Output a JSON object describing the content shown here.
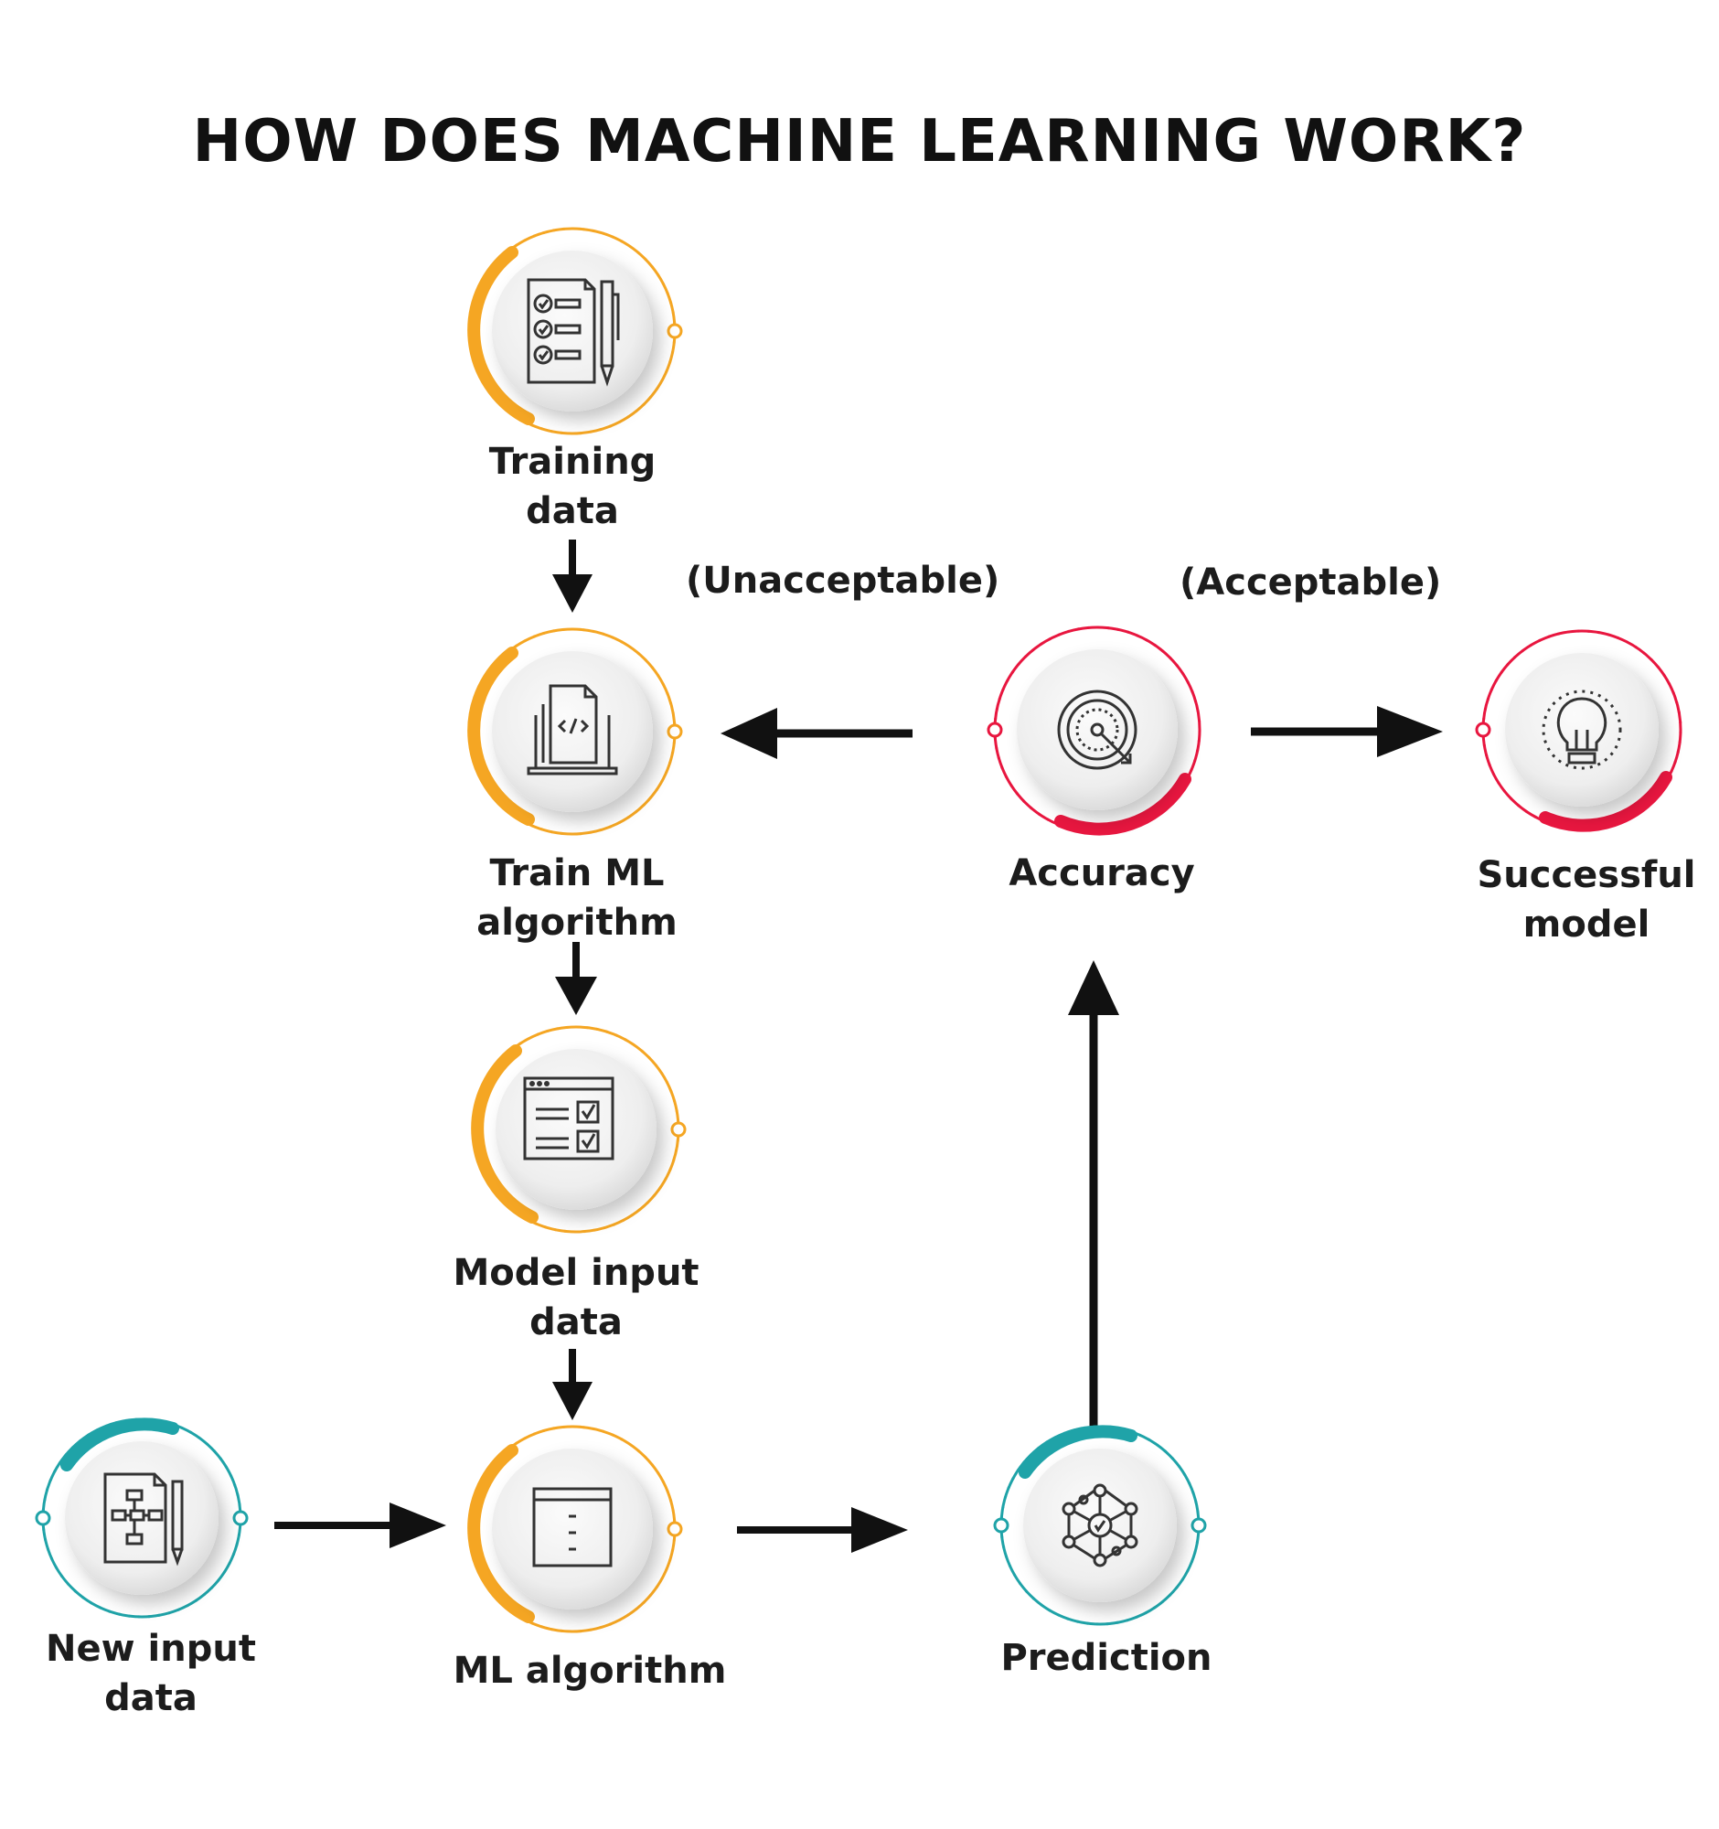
{
  "title": "HOW DOES MACHINE LEARNING WORK?",
  "nodes": {
    "training_data": {
      "line1": "Training",
      "line2": "data",
      "icon": "checklist-icon",
      "color": "#f5a623"
    },
    "train_ml_algorithm": {
      "line1": "Train ML",
      "line2": "algorithm",
      "icon": "code-file-laptop-icon",
      "color": "#f5a623"
    },
    "model_input_data": {
      "line1": "Model input",
      "line2": "data",
      "icon": "form-checkbox-icon",
      "color": "#f5a623"
    },
    "ml_algorithm": {
      "line1": "ML algorithm",
      "icon": "window-list-icon",
      "color": "#f5a623"
    },
    "new_input_data": {
      "line1": "New input",
      "line2": "data",
      "icon": "flowchart-document-icon",
      "color": "#1fa3a8"
    },
    "prediction": {
      "line1": "Prediction",
      "icon": "network-nodes-icon",
      "color": "#1fa3a8"
    },
    "accuracy": {
      "line1": "Accuracy",
      "icon": "target-icon",
      "color": "#e8163f"
    },
    "successful_model": {
      "line1": "Successful",
      "line2": "model",
      "icon": "lightbulb-icon",
      "color": "#e8163f"
    }
  },
  "edge_labels": {
    "unacceptable": "(Unacceptable)",
    "acceptable": "(Acceptable)"
  }
}
